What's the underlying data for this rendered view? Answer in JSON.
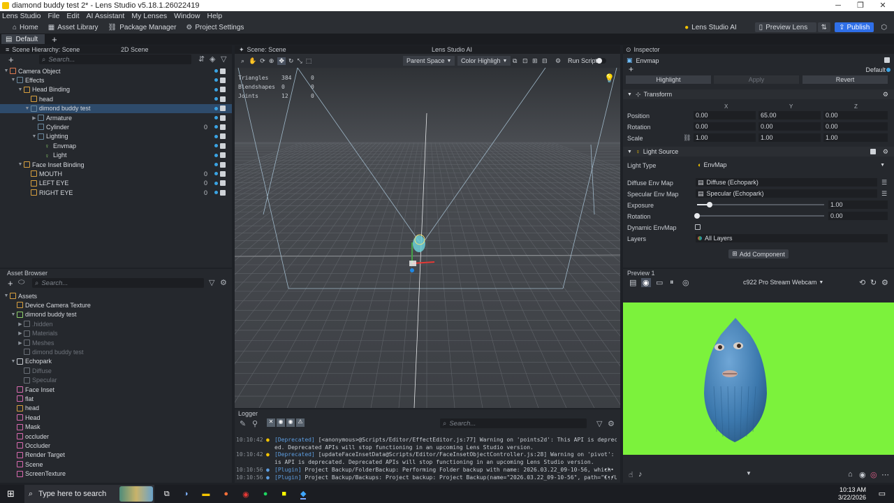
{
  "window": {
    "title": "diamond buddy test 2* - Lens Studio v5.18.1.26022419",
    "controls": [
      "─",
      "❐",
      "✕"
    ]
  },
  "menu": [
    "Lens Studio",
    "File",
    "Edit",
    "AI Assistant",
    "My Lenses",
    "Window",
    "Help"
  ],
  "toolbar": {
    "home": "Home",
    "asset_library": "Asset Library",
    "package_manager": "Package Manager",
    "project_settings": "Project Settings",
    "lens_studio_ai": "Lens Studio AI",
    "preview_lens": "Preview Lens",
    "publish": "Publish"
  },
  "tabs": {
    "default": "Default",
    "add": "+"
  },
  "hierarchy": {
    "title": "Scene Hierarchy: Scene",
    "tab2": "2D Scene",
    "search_placeholder": "Search...",
    "items": [
      {
        "label": "Camera Object"
      },
      {
        "label": "Effects"
      },
      {
        "label": "Head Binding"
      },
      {
        "label": "head"
      },
      {
        "label": "dimond buddy test"
      },
      {
        "label": "Armature"
      },
      {
        "label": "Cylinder",
        "count": "0"
      },
      {
        "label": "Lighting"
      },
      {
        "label": "Envmap"
      },
      {
        "label": "Light"
      },
      {
        "label": "Face Inset Binding"
      },
      {
        "label": "MOUTH",
        "count": "0"
      },
      {
        "label": "LEFT EYE",
        "count": "0"
      },
      {
        "label": "RIGHT EYE",
        "count": "0"
      }
    ]
  },
  "assets": {
    "title": "Asset Browser",
    "search_placeholder": "Search...",
    "items": [
      {
        "label": "Assets"
      },
      {
        "label": "Device Camera Texture"
      },
      {
        "label": "dimond buddy test"
      },
      {
        "label": ".hidden"
      },
      {
        "label": "Materials"
      },
      {
        "label": "Meshes"
      },
      {
        "label": "dimond buddy test"
      },
      {
        "label": "Echopark"
      },
      {
        "label": "Diffuse"
      },
      {
        "label": "Specular"
      },
      {
        "label": "Face Inset"
      },
      {
        "label": "flat"
      },
      {
        "label": "head"
      },
      {
        "label": "Head"
      },
      {
        "label": "Mask"
      },
      {
        "label": "occluder"
      },
      {
        "label": "Occluder"
      },
      {
        "label": "Render Target"
      },
      {
        "label": "Scene"
      },
      {
        "label": "ScreenTexture"
      }
    ]
  },
  "scene": {
    "title": "Scene: Scene",
    "ai_tab": "Lens Studio AI",
    "parent_space": "Parent Space",
    "color_highlight": "Color Highligh",
    "run_scripts": "Run Scripts",
    "stats": [
      {
        "label": "Triangles",
        "a": "384",
        "b": "0"
      },
      {
        "label": "Blendshapes",
        "a": "0",
        "b": "0"
      },
      {
        "label": "Joints",
        "a": "12",
        "b": "0"
      }
    ]
  },
  "logger": {
    "title": "Logger",
    "search_placeholder": "Search...",
    "lines": [
      {
        "ts": "10:10:42",
        "tag": "[Deprecated]",
        "text": " [<anonymous>@Scripts/Editor/EffectEditor.js:77] Warning on 'points2d': This API is deprecat"
      },
      {
        "ts": "",
        "tag": "",
        "text": "ed. Deprecated APIs will stop functioning in an upcoming Lens Studio version."
      },
      {
        "ts": "10:10:42",
        "tag": "[Deprecated]",
        "text": " [updateFaceInsetData@Scripts/Editor/FaceInsetObjectController.js:28] Warning on 'pivot': Th"
      },
      {
        "ts": "",
        "tag": "",
        "text": "is API is deprecated. Deprecated APIs will stop functioning in an upcoming Lens Studio version."
      },
      {
        "ts": "10:10:56",
        "tag": "[Plugin]",
        "text": " Project Backup/FolderBackup: Performing Folder backup with name: 2026.03.22_09-10-56, which"
      },
      {
        "ts": "10:10:56",
        "tag": "[Plugin]",
        "text": " Project Backup/Backups: Project backup: Project Backup(name=\"2026.03.22_09-10-56\", path=\"C:/U"
      }
    ]
  },
  "inspector": {
    "title": "Inspector",
    "object_name": "Envmap",
    "layer_default": "Default",
    "highlight": "Highlight",
    "apply": "Apply",
    "revert": "Revert",
    "transform": {
      "title": "Transform",
      "axes": [
        "X",
        "Y",
        "Z"
      ],
      "rows": [
        {
          "label": "Position",
          "values": [
            "0.00",
            "65.00",
            "0.00"
          ]
        },
        {
          "label": "Rotation",
          "values": [
            "0.00",
            "0.00",
            "0.00"
          ]
        },
        {
          "label": "Scale",
          "values": [
            "1.00",
            "1.00",
            "1.00"
          ]
        }
      ]
    },
    "light_source": {
      "title": "Light Source",
      "light_type_label": "Light Type",
      "light_type": "EnvMap",
      "diffuse_label": "Diffuse Env Map",
      "diffuse": "Diffuse (Echopark)",
      "specular_label": "Specular Env Map",
      "specular": "Specular (Echopark)",
      "exposure_label": "Exposure",
      "exposure": "1.00",
      "exposure_fraction": 0.1,
      "rotation_label": "Rotation",
      "rotation": "0.00",
      "rotation_fraction": 0.0,
      "dynamic_label": "Dynamic EnvMap",
      "layers_label": "Layers",
      "layers": "All Layers"
    },
    "add_component": "Add Component"
  },
  "preview": {
    "title": "Preview 1",
    "camera": "c922 Pro Stream Webcam",
    "bg_color": "#7cf23c"
  },
  "taskbar": {
    "search_placeholder": "Type here to search",
    "time": "10:13 AM",
    "date": "3/22/2026"
  },
  "colors": {
    "accent": "#2f6fe8",
    "selection": "#2e4b6b",
    "visible_dot": "#3aa3e3",
    "panel": "#25282d",
    "scene_bg": "#3a3d42"
  }
}
